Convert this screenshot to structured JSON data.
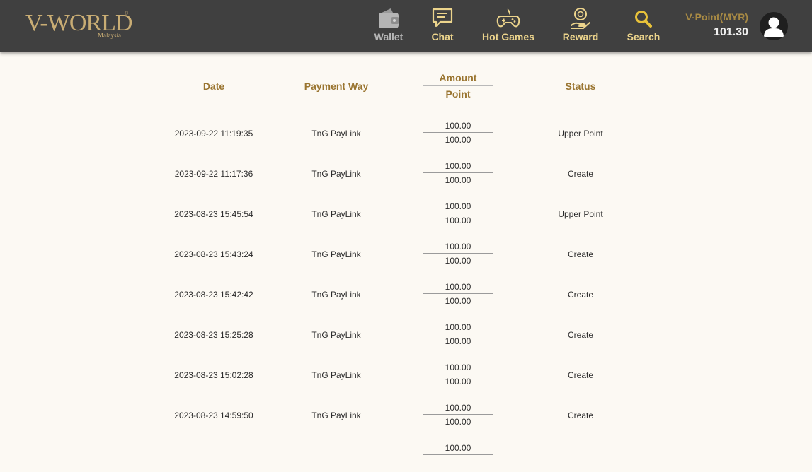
{
  "brand": {
    "logo_text": "V-WORLD",
    "logo_sub": "Malaysia",
    "logo_reg": "®"
  },
  "nav": [
    {
      "label": "Wallet",
      "icon": "wallet-icon"
    },
    {
      "label": "Chat",
      "icon": "chat-icon"
    },
    {
      "label": "Hot Games",
      "icon": "gamepad-icon"
    },
    {
      "label": "Reward",
      "icon": "reward-icon"
    },
    {
      "label": "Search",
      "icon": "search-icon"
    }
  ],
  "account": {
    "vpoint_label": "V-Point(MYR)",
    "vpoint_value": "101.30"
  },
  "colors": {
    "header_bg": "#404040",
    "gold": "#ecd48c",
    "column_header": "#9a7530",
    "page_bg": "#fcf9f3"
  },
  "table": {
    "headers": {
      "date": "Date",
      "payment_way": "Payment Way",
      "amount": "Amount",
      "point": "Point",
      "status": "Status"
    },
    "rows": [
      {
        "date": "2023-09-22 11:19:35",
        "payment": "TnG PayLink",
        "amount": "100.00",
        "point": "100.00",
        "status": "Upper Point"
      },
      {
        "date": "2023-09-22 11:17:36",
        "payment": "TnG PayLink",
        "amount": "100.00",
        "point": "100.00",
        "status": "Create"
      },
      {
        "date": "2023-08-23 15:45:54",
        "payment": "TnG PayLink",
        "amount": "100.00",
        "point": "100.00",
        "status": "Upper Point"
      },
      {
        "date": "2023-08-23 15:43:24",
        "payment": "TnG PayLink",
        "amount": "100.00",
        "point": "100.00",
        "status": "Create"
      },
      {
        "date": "2023-08-23 15:42:42",
        "payment": "TnG PayLink",
        "amount": "100.00",
        "point": "100.00",
        "status": "Create"
      },
      {
        "date": "2023-08-23 15:25:28",
        "payment": "TnG PayLink",
        "amount": "100.00",
        "point": "100.00",
        "status": "Create"
      },
      {
        "date": "2023-08-23 15:02:28",
        "payment": "TnG PayLink",
        "amount": "100.00",
        "point": "100.00",
        "status": "Create"
      },
      {
        "date": "2023-08-23 14:59:50",
        "payment": "TnG PayLink",
        "amount": "100.00",
        "point": "100.00",
        "status": "Create"
      },
      {
        "date": "",
        "payment": "",
        "amount": "100.00",
        "point": "",
        "status": ""
      }
    ]
  }
}
